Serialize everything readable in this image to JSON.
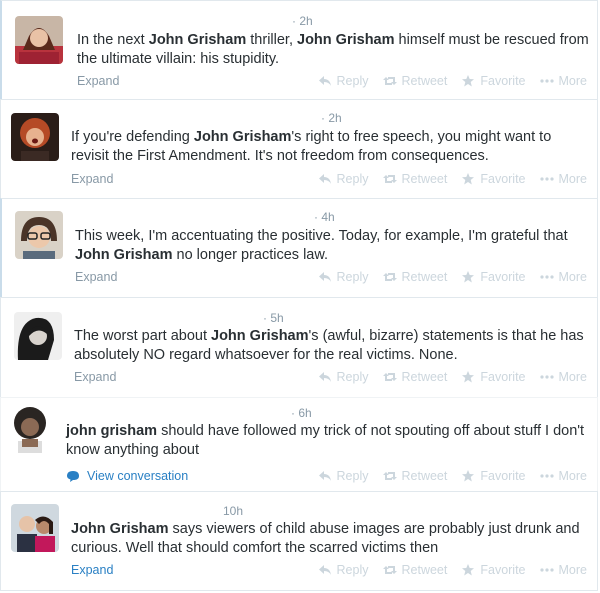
{
  "tweets": [
    {
      "time": "· 2h",
      "segments": [
        {
          "t": "In the next ",
          "b": false
        },
        {
          "t": "John Grisham",
          "b": true
        },
        {
          "t": " thriller, ",
          "b": false
        },
        {
          "t": "John Grisham",
          "b": true
        },
        {
          "t": " himself must be rescued from the ultimate villain: his stupidity.",
          "b": false
        }
      ],
      "footer": "Expand"
    },
    {
      "time": "· 2h",
      "segments": [
        {
          "t": "If you're defending ",
          "b": false
        },
        {
          "t": "John Grisham",
          "b": true
        },
        {
          "t": "'s right to free speech, you might want to revisit the First Amendment. It's not freedom from consequences.",
          "b": false
        }
      ],
      "footer": "Expand"
    },
    {
      "time": "· 4h",
      "segments": [
        {
          "t": "This week, I'm accentuating the positive. Today, for example, I'm grateful that ",
          "b": false
        },
        {
          "t": "John Grisham",
          "b": true
        },
        {
          "t": " no longer practices law.",
          "b": false
        }
      ],
      "footer": "Expand"
    },
    {
      "time": "· 5h",
      "segments": [
        {
          "t": "The worst part about ",
          "b": false
        },
        {
          "t": "John Grisham",
          "b": true
        },
        {
          "t": "'s (awful, bizarre) statements is that he has absolutely NO regard whatsoever for the real victims. None.",
          "b": false
        }
      ],
      "footer": "Expand"
    },
    {
      "time": "· 6h",
      "segments": [
        {
          "t": "john grisham",
          "b": true
        },
        {
          "t": " should have followed my trick of not spouting off about stuff I don't know anything about",
          "b": false
        }
      ],
      "footer": "View conversation"
    },
    {
      "time": "10h",
      "segments": [
        {
          "t": "John Grisham",
          "b": true
        },
        {
          "t": " says viewers of child abuse images are probably just drunk and curious. Well that should comfort the scarred victims then",
          "b": false
        }
      ],
      "footer": "Expand"
    }
  ],
  "actions": {
    "reply": "Reply",
    "retweet": "Retweet",
    "favorite": "Favorite",
    "more": "More"
  },
  "colors": {
    "muted": "#8899a6",
    "link": "#2a80c4",
    "action": "#ccd6dd",
    "border": "#e1e8ed"
  }
}
